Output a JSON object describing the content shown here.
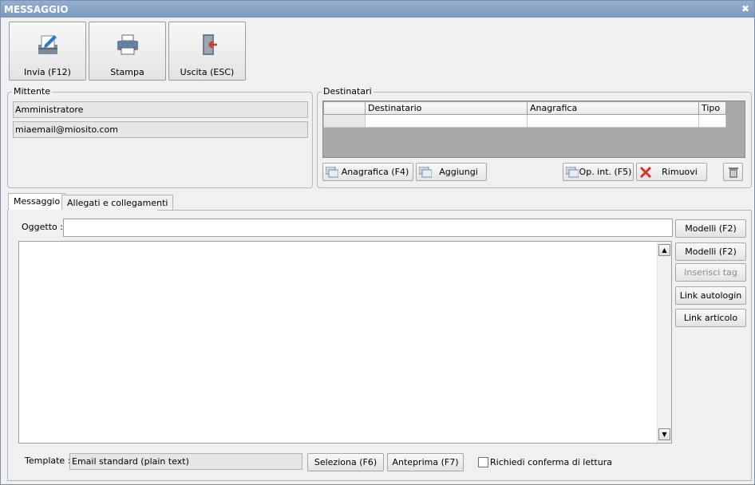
{
  "window": {
    "title": "MESSAGGIO",
    "close_glyph": "✖"
  },
  "toolbar": {
    "send_label": "Invia (F12)",
    "print_label": "Stampa",
    "exit_label": "Uscita (ESC)"
  },
  "sender": {
    "group_title": "Mittente",
    "name": "Amministratore",
    "email": "miaemail@miosito.com"
  },
  "recipients": {
    "group_title": "Destinatari",
    "columns": [
      "Destinatario",
      "Anagrafica",
      "Tipo"
    ],
    "rows": [],
    "anagrafica_button": "Anagrafica (F4)",
    "add_button": "Aggiungi",
    "op_int_button": "Op. int. (F5)",
    "remove_button": "Rimuovi"
  },
  "tabs": {
    "message": "Messaggio",
    "attachments": "Allegati e collegamenti"
  },
  "message": {
    "subject_label": "Oggetto :",
    "subject_value": "",
    "body_value": "",
    "models_button_subject": "Modelli (F2)",
    "models_button_body": "Modelli (F2)",
    "insert_tag_button": "Inserisci tag",
    "autologin_button": "Link autologin",
    "article_button": "Link articolo"
  },
  "template": {
    "label": "Template :",
    "value": "Email standard (plain text)",
    "select_button": "Seleziona (F6)",
    "preview_button": "Anteprima (F7)",
    "read_receipt_label": "Richiedi conferma di lettura",
    "read_receipt_checked": false
  },
  "colors": {
    "titlebar": "#7c98bf",
    "window_bg": "#f0f0f0",
    "remove_icon": "#d9342b",
    "exit_icon": "#d9342b"
  }
}
